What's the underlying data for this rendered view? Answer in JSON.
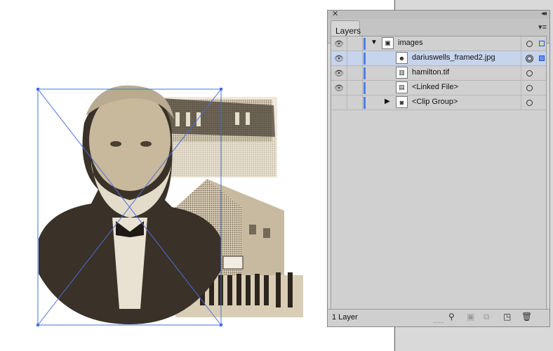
{
  "panel": {
    "tab_label": "Layers",
    "close_glyph": "✕",
    "collapse_glyph": "◂◂",
    "menu_glyph": "▾≡",
    "footer_count": "1 Layer",
    "footer_icons": [
      "search-icon",
      "make-clip-mask-icon",
      "sublayer-icon",
      "new-layer-icon",
      "delete-icon"
    ]
  },
  "layers": [
    {
      "label": "images",
      "visible": true,
      "expanded": true,
      "indent": 0,
      "thumb_icon": "images-thumb",
      "selected": false
    },
    {
      "label": "dariuswells_framed2.jpg",
      "visible": true,
      "expanded": null,
      "indent": 1,
      "thumb_icon": "portrait-thumb",
      "selected": true
    },
    {
      "label": "hamilton.tif",
      "visible": true,
      "expanded": null,
      "indent": 1,
      "thumb_icon": "building-thumb",
      "selected": false
    },
    {
      "label": "<Linked File>",
      "visible": true,
      "expanded": null,
      "indent": 1,
      "thumb_icon": "linked-file-thumb",
      "selected": false
    },
    {
      "label": "<Clip Group>",
      "visible": false,
      "expanded": false,
      "indent": 1,
      "thumb_icon": "clip-group-thumb",
      "selected": false
    }
  ],
  "colors": {
    "layer_color": "#4f7fe8",
    "selection_row": "#c6d4ec",
    "frame_color": "#4a6fd8"
  }
}
